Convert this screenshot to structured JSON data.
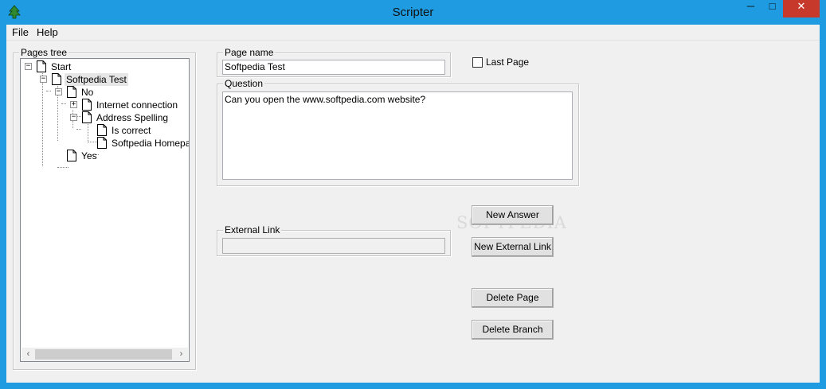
{
  "window": {
    "title": "Scripter",
    "minimize_glyph": "─",
    "maximize_glyph": "□",
    "close_glyph": "✕"
  },
  "menu": {
    "items": [
      "File",
      "Help"
    ]
  },
  "pages_tree": {
    "label": "Pages tree",
    "nodes": [
      {
        "label": "Start",
        "expander": "−"
      },
      {
        "label": "Softpedia Test",
        "expander": "−",
        "selected": true
      },
      {
        "label": "No",
        "expander": "−"
      },
      {
        "label": "Internet connection",
        "expander": "+"
      },
      {
        "label": "Address Spelling",
        "expander": "−"
      },
      {
        "label": "Is correct",
        "expander": ""
      },
      {
        "label": "Softpedia Homepage",
        "expander": ""
      },
      {
        "label": "Yes",
        "expander": ""
      }
    ],
    "scroll_left": "‹",
    "scroll_right": "›"
  },
  "page_name": {
    "label": "Page name",
    "value": "Softpedia Test"
  },
  "last_page": {
    "label": "Last Page",
    "checked": false
  },
  "question": {
    "label": "Question",
    "value": "Can you open the www.softpedia.com website?"
  },
  "external_link": {
    "label": "External Link",
    "value": ""
  },
  "buttons": {
    "new_answer": "New Answer",
    "new_external_link": "New External Link",
    "delete_page": "Delete Page",
    "delete_branch": "Delete Branch"
  },
  "watermark": "SOFTPEDIA",
  "colors": {
    "titlebar": "#1e9be1",
    "close": "#c7392b",
    "client": "#f0f0f0"
  }
}
